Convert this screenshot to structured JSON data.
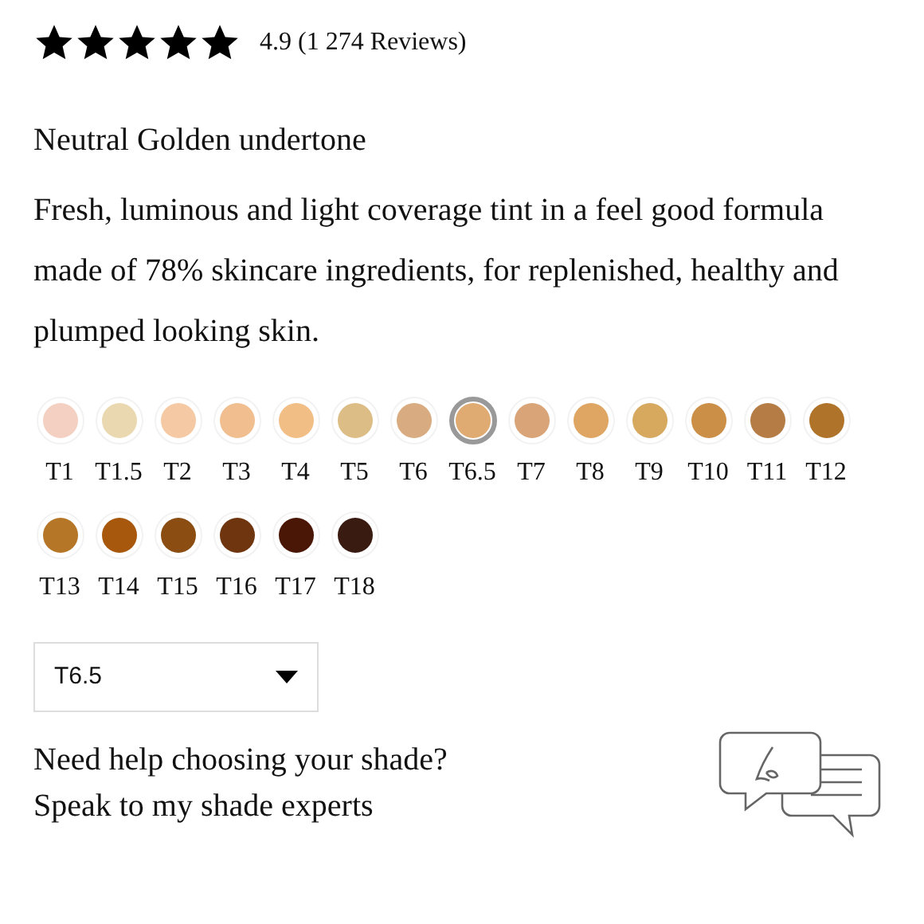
{
  "rating": {
    "stars": 5,
    "summary": "4.9 (1 274 Reviews)"
  },
  "undertone": "Neutral Golden undertone",
  "description": "Fresh, luminous and light coverage tint in a feel good formula made of 78% skincare ingredients, for replenished, healthy and plumped looking skin.",
  "shades": [
    {
      "label": "T1",
      "color": "#f4d0c2",
      "selected": false
    },
    {
      "label": "T1.5",
      "color": "#ead9b0",
      "selected": false
    },
    {
      "label": "T2",
      "color": "#f4c9a4",
      "selected": false
    },
    {
      "label": "T3",
      "color": "#f1bf8f",
      "selected": false
    },
    {
      "label": "T4",
      "color": "#f1be86",
      "selected": false
    },
    {
      "label": "T5",
      "color": "#dcbd86",
      "selected": false
    },
    {
      "label": "T6",
      "color": "#d8ac80",
      "selected": false
    },
    {
      "label": "T6.5",
      "color": "#e0aa73",
      "selected": true
    },
    {
      "label": "T7",
      "color": "#d9a478",
      "selected": false
    },
    {
      "label": "T8",
      "color": "#dea563",
      "selected": false
    },
    {
      "label": "T9",
      "color": "#d6a95f",
      "selected": false
    },
    {
      "label": "T10",
      "color": "#cb8f48",
      "selected": false
    },
    {
      "label": "T11",
      "color": "#b67c45",
      "selected": false
    },
    {
      "label": "T12",
      "color": "#b0732a",
      "selected": false
    },
    {
      "label": "T13",
      "color": "#b57727",
      "selected": false
    },
    {
      "label": "T14",
      "color": "#a7580d",
      "selected": false
    },
    {
      "label": "T15",
      "color": "#8b4d12",
      "selected": false
    },
    {
      "label": "T16",
      "color": "#6e350f",
      "selected": false
    },
    {
      "label": "T17",
      "color": "#4a1605",
      "selected": false
    },
    {
      "label": "T18",
      "color": "#3a1b12",
      "selected": false
    }
  ],
  "shade_select": {
    "value": "T6.5"
  },
  "help": {
    "question": "Need help choosing your shade?",
    "link": "Speak to my shade experts"
  }
}
